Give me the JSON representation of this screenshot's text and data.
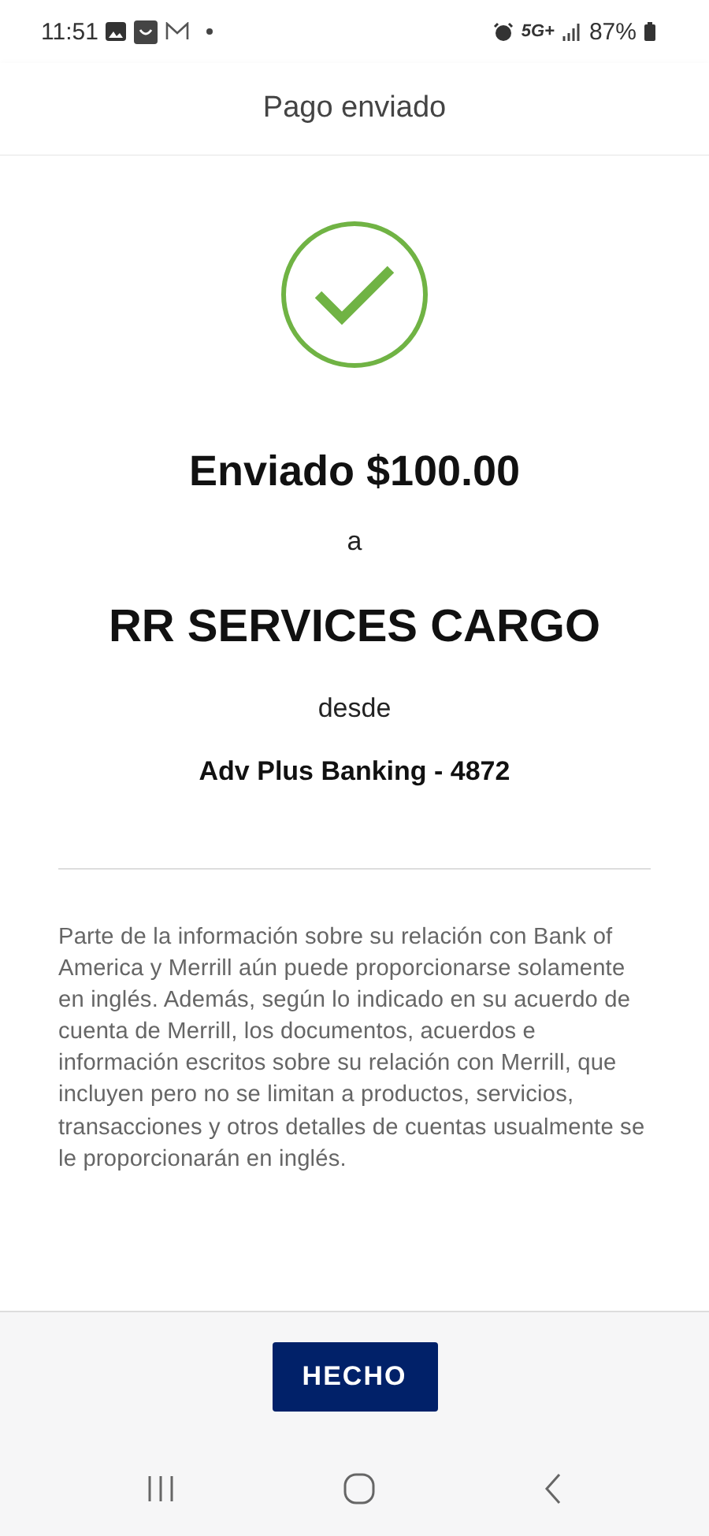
{
  "status_bar": {
    "time": "11:51",
    "network": "5G+",
    "battery": "87%"
  },
  "header": {
    "title": "Pago enviado"
  },
  "confirmation": {
    "amount_line": "Enviado $100.00",
    "connector_to": "a",
    "recipient": "RR SERVICES CARGO",
    "connector_from": "desde",
    "account": "Adv Plus Banking - 4872"
  },
  "disclaimer": "Parte de la información sobre su relación con Bank of America y Merrill aún puede proporcionarse solamente en inglés. Además, según lo indicado en su acuerdo de cuenta de Merrill, los documentos, acuerdos e información escritos sobre su relación con Merrill, que incluyen pero no se limitan a productos, servicios, transacciones y otros detalles de cuentas usualmente se le proporcionarán en inglés.",
  "done_button": "HECHO"
}
